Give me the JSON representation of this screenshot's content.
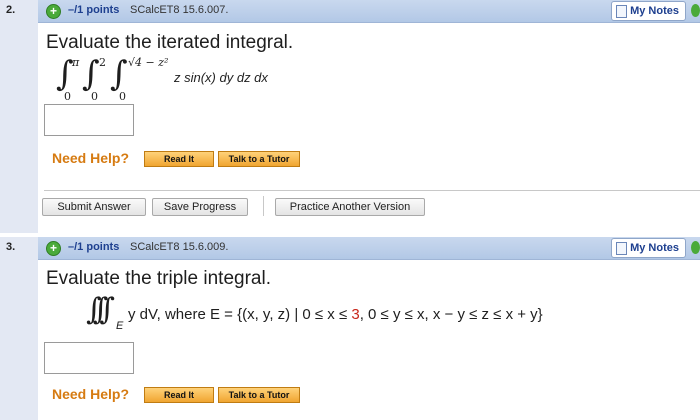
{
  "q2": {
    "number": "2.",
    "points": "–/1 points",
    "code": "SCalcET8 15.6.007.",
    "notes": "My Notes",
    "prompt": "Evaluate the iterated integral.",
    "integral": {
      "upper1": "π",
      "upper2": "2",
      "upper3": "√4 − z²",
      "lower1": "0",
      "lower2": "0",
      "lower3": "0",
      "integrand": "z sin(x) dy dz dx"
    },
    "need_help": "Need Help?",
    "read_it": "Read It",
    "talk_tutor": "Talk to a Tutor",
    "submit": "Submit Answer",
    "save": "Save Progress",
    "practice": "Practice Another Version"
  },
  "q3": {
    "number": "3.",
    "points": "–/1 points",
    "code": "SCalcET8 15.6.009.",
    "notes": "My Notes",
    "prompt": "Evaluate the triple integral.",
    "integral": {
      "region": "E",
      "expr_a": "y dV, where E = {(x, y, z) | 0 ≤ x ≤ ",
      "highlight": "3",
      "expr_b": ", 0 ≤ y ≤ x, x − y ≤ z ≤ x + y}"
    },
    "need_help": "Need Help?",
    "read_it": "Read It",
    "talk_tutor": "Talk to a Tutor"
  }
}
